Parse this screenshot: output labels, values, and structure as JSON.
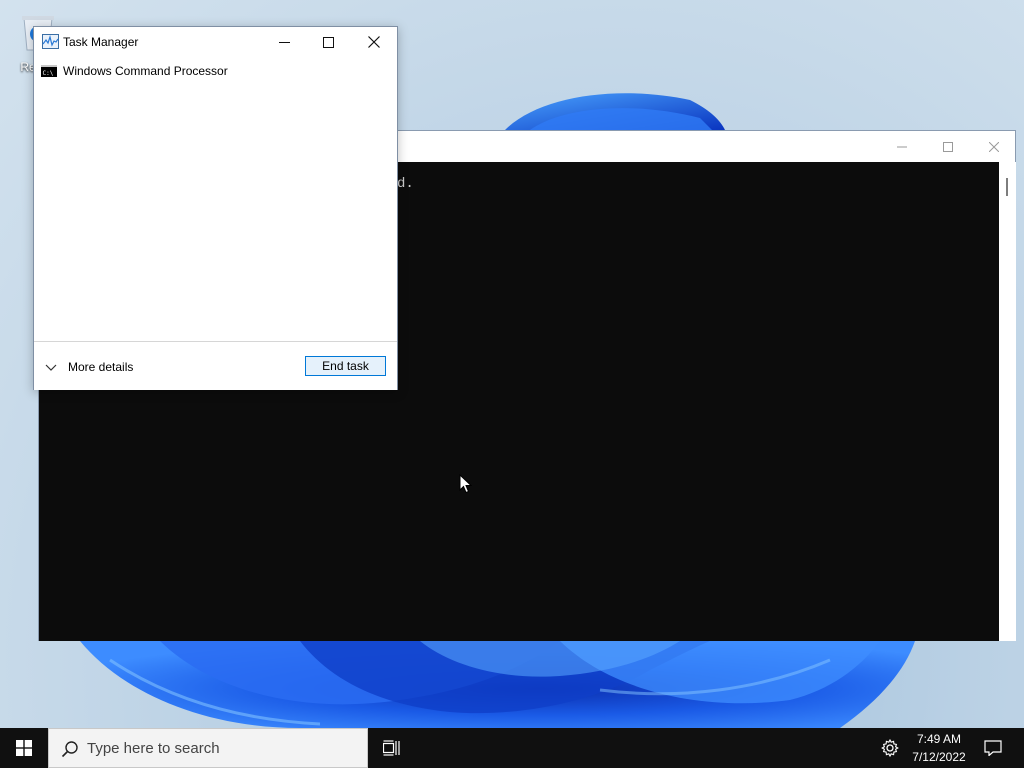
{
  "desktop": {
    "recycle_bin_label": "Recy"
  },
  "console_window": {
    "visible_text": "d."
  },
  "task_manager": {
    "title": "Task Manager",
    "items": [
      {
        "label": "Windows Command Processor",
        "icon": "cmd-icon"
      }
    ],
    "more_details": "More details",
    "end_task": "End task"
  },
  "taskbar": {
    "search_placeholder": "Type here to search",
    "time": "7:49 AM",
    "date": "7/12/2022"
  },
  "colors": {
    "console_bg": "#0c0c0c",
    "taskbar_bg": "#101010",
    "accent": "#0078d7",
    "wallpaper_bloom": "#1f5fe0"
  }
}
